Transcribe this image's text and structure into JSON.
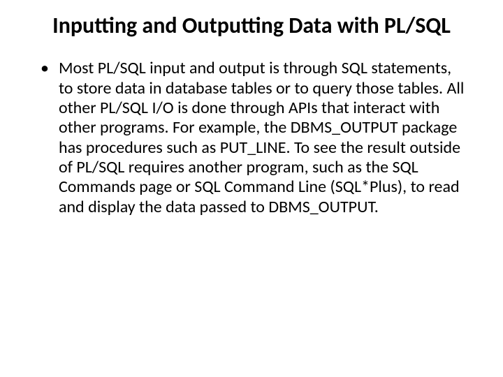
{
  "title": "Inputting and Outputting Data with PL/SQL",
  "bullet": {
    "marker": "•",
    "text": "Most PL/SQL input and output is through SQL statements, to store data in database tables or to query those tables. All other PL/SQL I/O is done through APIs that interact with other programs. For example, the DBMS_OUTPUT package has procedures such as PUT_LINE. To see the result outside of PL/SQL requires another program, such as the SQL Commands page or SQL Command Line (SQL*Plus), to read and display the data passed to DBMS_OUTPUT."
  }
}
